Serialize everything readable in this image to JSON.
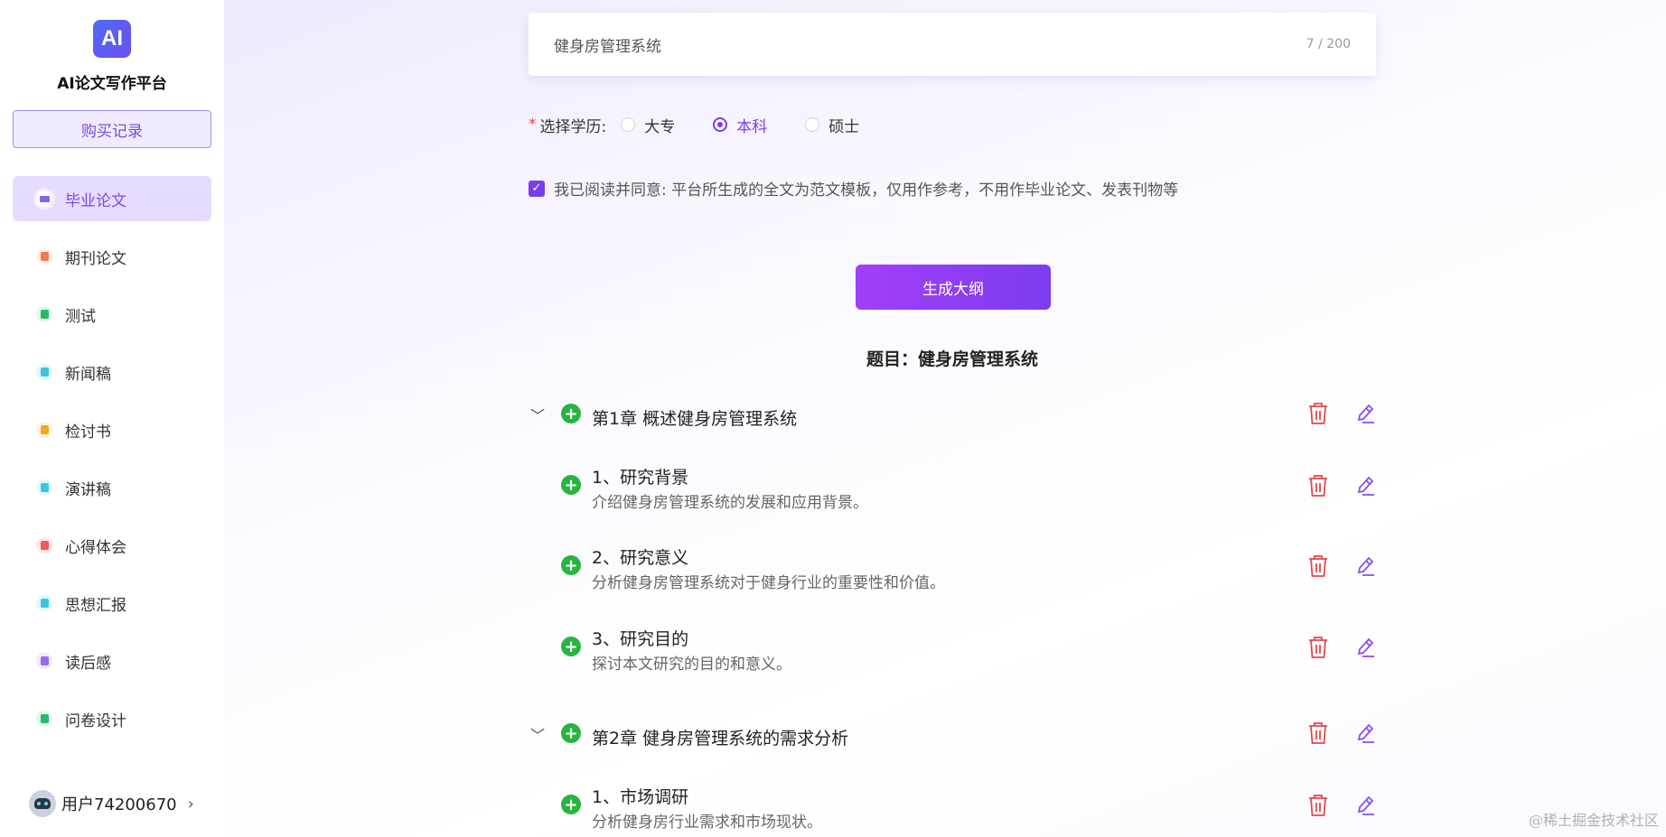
{
  "app": {
    "logo_text": "AI",
    "title": "AI论文写作平台",
    "purchase_label": "购买记录"
  },
  "sidebar": {
    "items": [
      {
        "label": "毕业论文",
        "icon": "graduation-cap-icon",
        "color": "#8a63e8",
        "active": true
      },
      {
        "label": "期刊论文",
        "icon": "journal-icon",
        "color": "#f07a54",
        "active": false
      },
      {
        "label": "测试",
        "icon": "test-icon",
        "color": "#28b96b",
        "active": false
      },
      {
        "label": "新闻稿",
        "icon": "news-icon",
        "color": "#3ec4e0",
        "active": false
      },
      {
        "label": "检讨书",
        "icon": "review-icon",
        "color": "#f5a623",
        "active": false
      },
      {
        "label": "演讲稿",
        "icon": "speech-icon",
        "color": "#3ec4e0",
        "active": false
      },
      {
        "label": "心得体会",
        "icon": "insight-icon",
        "color": "#ef5a5a",
        "active": false
      },
      {
        "label": "思想汇报",
        "icon": "report-icon",
        "color": "#3ec4e0",
        "active": false
      },
      {
        "label": "读后感",
        "icon": "book-icon",
        "color": "#9a6ae8",
        "active": false
      },
      {
        "label": "问卷设计",
        "icon": "survey-icon",
        "color": "#28b96b",
        "active": false
      }
    ],
    "user": {
      "name": "用户74200670"
    }
  },
  "form": {
    "topic_value": "健身房管理系统",
    "char_count": "7 / 200",
    "education_label": "选择学历:",
    "education_options": [
      "大专",
      "本科",
      "硕士"
    ],
    "education_selected": "本科",
    "agree_text": "我已阅读并同意: 平台所生成的全文为范文模板，仅用作参考，不用作毕业论文、发表刊物等",
    "generate_label": "生成大纲"
  },
  "outline": {
    "title": "题目：健身房管理系统",
    "rows": [
      {
        "kind": "chapter",
        "title": "第1章 概述健身房管理系统"
      },
      {
        "kind": "section",
        "title": "1、研究背景",
        "desc": "介绍健身房管理系统的发展和应用背景。"
      },
      {
        "kind": "section",
        "title": "2、研究意义",
        "desc": "分析健身房管理系统对于健身行业的重要性和价值。"
      },
      {
        "kind": "section",
        "title": "3、研究目的",
        "desc": "探讨本文研究的目的和意义。"
      },
      {
        "kind": "chapter",
        "title": "第2章 健身房管理系统的需求分析"
      },
      {
        "kind": "section",
        "title": "1、市场调研",
        "desc": "分析健身房行业需求和市场现状。"
      }
    ]
  },
  "colors": {
    "accent": "#7b3cf0",
    "plus_green": "#27b441",
    "trash_red": "#e0484e",
    "edit_purple": "#8a4cf0"
  },
  "watermark": "@稀土掘金技术社区"
}
